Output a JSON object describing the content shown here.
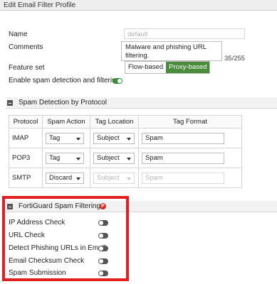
{
  "window": {
    "title": "Edit Email Filter Profile"
  },
  "form": {
    "name_label": "Name",
    "name_value": "default",
    "comments_label": "Comments",
    "comments_line1": "Malware and phishing URL",
    "comments_line2": "filtering.",
    "comments_counter": "35/255",
    "feature_set_label": "Feature set",
    "feature_set_options": [
      "Flow-based",
      "Proxy-based"
    ],
    "feature_set_selected": "Proxy-based",
    "enable_label": "Enable spam detection and filtering",
    "enable_on": true
  },
  "spam_detection": {
    "header": "Spam Detection by Protocol",
    "columns": [
      "Protocol",
      "Spam Action",
      "Tag Location",
      "Tag Format"
    ],
    "rows": [
      {
        "protocol": "IMAP",
        "action": "Tag",
        "location": "Subject",
        "format": "Spam",
        "disabled": false
      },
      {
        "protocol": "POP3",
        "action": "Tag",
        "location": "Subject",
        "format": "Spam",
        "disabled": false
      },
      {
        "protocol": "SMTP",
        "action": "Discard",
        "location": "Subject",
        "format": "Spam",
        "disabled": true
      }
    ]
  },
  "fortiguard": {
    "header": "FortiGuard Spam Filtering",
    "badge": "P",
    "items": [
      {
        "label": "IP Address Check",
        "on": false
      },
      {
        "label": "URL Check",
        "on": false
      },
      {
        "label": "Detect Phishing URLs in Email",
        "on": false
      },
      {
        "label": "Email Checksum Check",
        "on": false
      },
      {
        "label": "Spam Submission",
        "on": false
      }
    ]
  },
  "colors": {
    "accent_green": "#4a8c3c",
    "highlight_red": "#e0201e",
    "badge_red": "#d9271d"
  }
}
